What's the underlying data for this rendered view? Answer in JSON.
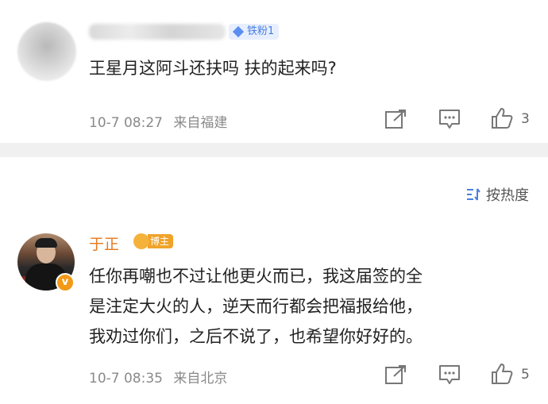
{
  "comments": [
    {
      "badge": "铁粉1",
      "text": "王星月这阿斗还扶吗 扶的起来吗?",
      "time": "10-7 08:27",
      "location": "来自福建",
      "likes": "3"
    },
    {
      "username": "于正",
      "badge": "博主",
      "verified_icon": "v",
      "text_lines": [
        "任你再嘲也不过让他更火而已，我这届签的全",
        "是注定大火的人，逆天而行都会把福报给他，",
        "我劝过你们，之后不说了，也希望你好好的。"
      ],
      "time": "10-7 08:35",
      "location": "来自北京",
      "likes": "5"
    }
  ],
  "sort": {
    "label": "按热度",
    "icon": "sort-icon"
  },
  "icons": {
    "share": "share-icon",
    "comment": "comment-icon",
    "like": "thumbs-up-icon"
  },
  "colors": {
    "accent": "#e4781f",
    "badge_blue": "#4a7ee0",
    "meta": "#8a8a8a"
  }
}
